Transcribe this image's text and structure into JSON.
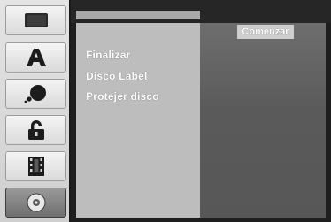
{
  "sidebar": {
    "tabs": [
      {
        "icon": "dvd-player-icon",
        "active": false
      },
      {
        "icon": "title-letter-a-icon",
        "active": false
      },
      {
        "icon": "audio-bubble-icon",
        "active": false
      },
      {
        "icon": "padlock-icon",
        "active": false
      },
      {
        "icon": "film-strip-icon",
        "active": false
      },
      {
        "icon": "disc-icon",
        "active": true
      }
    ]
  },
  "menu": {
    "items": [
      {
        "label": "Finalizar"
      },
      {
        "label": "Disco Label"
      },
      {
        "label": "Protejer disco"
      }
    ],
    "action_button": "Comenzar"
  },
  "colors": {
    "panel_dark": "#1e1e1e",
    "menu_column": "#bdbdbd",
    "right_area": "#5a5a5a",
    "button": "#cfcfcf",
    "text": "#ffffff"
  }
}
